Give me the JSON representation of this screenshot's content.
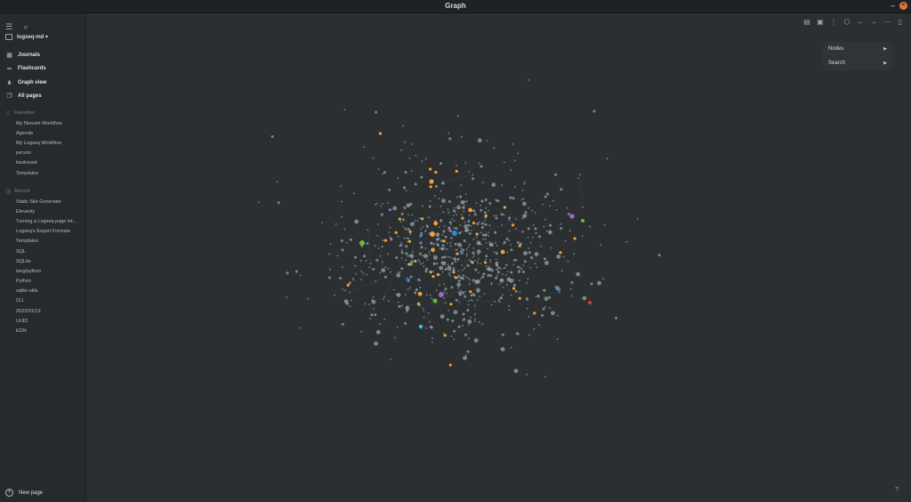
{
  "window": {
    "title": "Graph"
  },
  "sidebar": {
    "graph_name": "logseq-md",
    "nav": [
      {
        "label": "Journals",
        "icon": "calendar-icon"
      },
      {
        "label": "Flashcards",
        "icon": "infinity-icon"
      },
      {
        "label": "Graph view",
        "icon": "graph-icon"
      },
      {
        "label": "All pages",
        "icon": "pages-icon"
      }
    ],
    "favorites_label": "Favorites",
    "favorites": [
      "My Neovim Workflow",
      "Agenda",
      "My Logseq Workflow",
      "person",
      "bookmark",
      "Templates"
    ],
    "recent_label": "Recent",
    "recent": [
      "Static Site Generator",
      "Eleventy",
      "Turning a Logseq page int...",
      "Logseq's Export Formats",
      "Templates",
      "SQL",
      "SQLite",
      "lang/python",
      "Python",
      "sqlite-utils",
      "CLI",
      "2022/01/13",
      "UUID",
      "EDN"
    ],
    "new_page": "New page"
  },
  "menu": {
    "items": [
      "Nodes",
      "Search"
    ]
  },
  "help": "?",
  "colors": {
    "node": "#97a3a8",
    "page_accent": "#f0a037",
    "violet": "#9d6ad0",
    "blue": "#2f84d6",
    "cyan": "#2cc6d8",
    "green": "#66bf2f",
    "red": "#e3342f",
    "link": "#3c5058"
  }
}
